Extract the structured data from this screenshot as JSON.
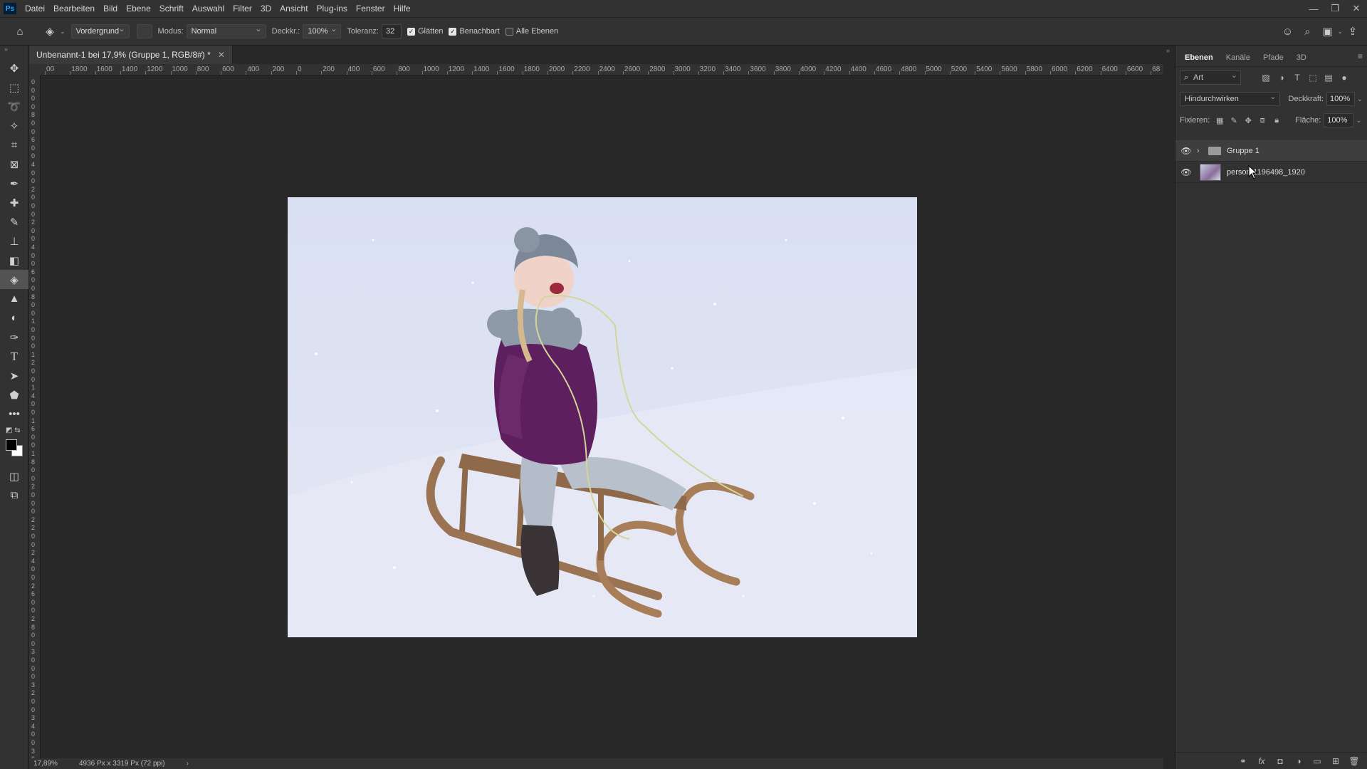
{
  "app": {
    "logo": "Ps"
  },
  "menu": [
    "Datei",
    "Bearbeiten",
    "Bild",
    "Ebene",
    "Schrift",
    "Auswahl",
    "Filter",
    "3D",
    "Ansicht",
    "Plug-ins",
    "Fenster",
    "Hilfe"
  ],
  "options": {
    "fill_source": "Vordergrund",
    "mode_label": "Modus:",
    "mode_value": "Normal",
    "opacity_label": "Deckkr.:",
    "opacity_value": "100%",
    "tolerance_label": "Toleranz:",
    "tolerance_value": "32",
    "antialias_label": "Glätten",
    "contiguous_label": "Benachbart",
    "all_layers_label": "Alle Ebenen"
  },
  "document": {
    "tab_title": "Unbenannt-1 bei 17,9% (Gruppe 1, RGB/8#) *",
    "zoom": "17,89%",
    "size": "4936 Px x 3319 Px (72 ppi)",
    "ruler_h": [
      "00",
      "1800",
      "1600",
      "1400",
      "1200",
      "1000",
      "800",
      "600",
      "400",
      "200",
      "0",
      "200",
      "400",
      "600",
      "800",
      "1000",
      "1200",
      "1400",
      "1600",
      "1800",
      "2000",
      "2200",
      "2400",
      "2600",
      "2800",
      "3000",
      "3200",
      "3400",
      "3600",
      "3800",
      "4000",
      "4200",
      "4400",
      "4600",
      "4800",
      "5000",
      "5200",
      "5400",
      "5600",
      "5800",
      "6000",
      "6200",
      "6400",
      "6600",
      "68"
    ],
    "ruler_v": [
      "0",
      "0",
      "0",
      "0",
      "8",
      "0",
      "0",
      "6",
      "0",
      "0",
      "4",
      "0",
      "0",
      "2",
      "0",
      "0",
      "0",
      "2",
      "0",
      "0",
      "4",
      "0",
      "0",
      "6",
      "0",
      "0",
      "8",
      "0",
      "0",
      "1",
      "0",
      "0",
      "0",
      "1",
      "2",
      "0",
      "0",
      "1",
      "4",
      "0",
      "0",
      "1",
      "6",
      "0",
      "0",
      "1",
      "8",
      "0",
      "0",
      "2",
      "0",
      "0",
      "0",
      "2",
      "2",
      "0",
      "0",
      "2",
      "4",
      "0",
      "0",
      "2",
      "6",
      "0",
      "0",
      "2",
      "8",
      "0",
      "0",
      "3",
      "0",
      "0",
      "0",
      "3",
      "2",
      "0",
      "0",
      "3",
      "4",
      "0",
      "0",
      "3",
      "6",
      "0",
      "0"
    ]
  },
  "panel": {
    "tabs": [
      "Ebenen",
      "Kanäle",
      "Pfade",
      "3D"
    ],
    "filter_kind": "Art",
    "blend_mode": "Hindurchwirken",
    "opacity_label": "Deckkraft:",
    "opacity_value": "100%",
    "lock_label": "Fixieren:",
    "fill_label": "Fläche:",
    "fill_value": "100%",
    "layers": [
      {
        "name": "Gruppe 1",
        "type": "group"
      },
      {
        "name": "person-1196498_1920",
        "type": "pixel"
      }
    ]
  },
  "colors": {
    "foreground": "#000000",
    "background": "#ffffff",
    "accent": "#31a8ff"
  }
}
